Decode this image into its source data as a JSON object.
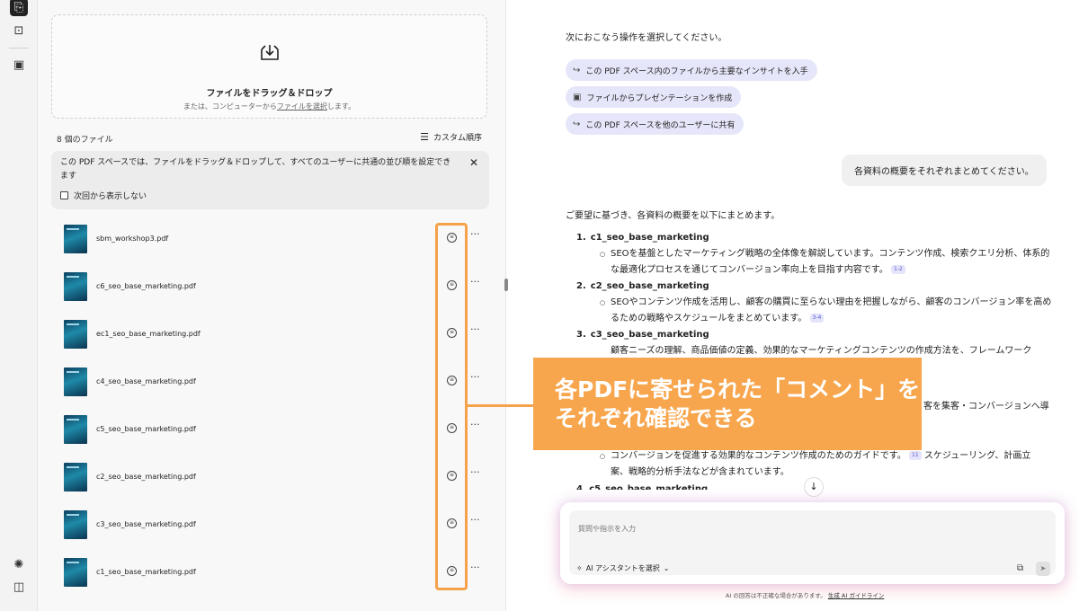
{
  "rail": {
    "icons": [
      "files-icon",
      "insight-icon",
      "presentation-icon"
    ],
    "bottom_icons": [
      "lightbulb-icon",
      "panel-toggle-icon"
    ]
  },
  "left_panel": {
    "dropzone": {
      "title": "ファイルをドラッグ＆ドロップ",
      "sub_prefix": "または、コンピューターから",
      "sub_link": "ファイルを選択",
      "sub_suffix": "します。"
    },
    "file_count": "8 個のファイル",
    "sort_label": "カスタム順序",
    "notice": {
      "text": "この PDF スペースでは、ファイルをドラッグ＆ドロップして、すべてのユーザーに共通の並び順を設定できます",
      "checkbox_label": "次回から表示しない"
    },
    "files": [
      {
        "name": "sbm_workshop3.pdf"
      },
      {
        "name": "c6_seo_base_marketing.pdf"
      },
      {
        "name": "ec1_seo_base_marketing.pdf"
      },
      {
        "name": "c4_seo_base_marketing.pdf"
      },
      {
        "name": "c5_seo_base_marketing.pdf"
      },
      {
        "name": "c2_seo_base_marketing.pdf"
      },
      {
        "name": "c3_seo_base_marketing.pdf"
      },
      {
        "name": "c1_seo_base_marketing.pdf"
      }
    ],
    "more_label": "···",
    "comment_glyph": "≡"
  },
  "callout": {
    "line1": "各PDFに寄せられた「コメント」を",
    "line2": "それぞれ確認できる",
    "color": "#f7a64d"
  },
  "right_panel": {
    "prompt_label": "次におこなう操作を選択してください。",
    "chips": [
      {
        "icon": "arrow-icon",
        "glyph": "↪",
        "label": "この PDF スペース内のファイルから主要なインサイトを入手"
      },
      {
        "icon": "presentation-icon",
        "glyph": "▣",
        "label": "ファイルからプレゼンテーションを作成"
      },
      {
        "icon": "arrow-icon",
        "glyph": "↪",
        "label": "この PDF スペースを他のユーザーに共有"
      }
    ],
    "user_message": "各資料の概要をそれぞれまとめてください。",
    "reply_intro": "ご要望に基づき、各資料の概要を以下にまとめます。",
    "summary": [
      {
        "num": "1.",
        "title": "c1_seo_base_marketing",
        "desc": "SEOを基盤としたマーケティング戦略の全体像を解説しています。コンテンツ作成、検索クエリ分析、体系的な最適化プロセスを通じてコンバージョン率向上を目指す内容です。",
        "ref": "1-2"
      },
      {
        "num": "2.",
        "title": "c2_seo_base_marketing",
        "desc": "SEOやコンテンツ作成を活用し、顧客の購買に至らない理由を把握しながら、顧客のコンバージョン率を高めるための戦略やスケジュールをまとめています。",
        "ref": "3-4"
      },
      {
        "num": "3.",
        "title": "c3_seo_base_marketing",
        "desc": "顧客ニーズの理解、商品価値の定義、効果的なマーケティングコンテンツの作成方法を、フレームワーク",
        "ref": ""
      }
    ],
    "summary_tail_1": "客を集客・コンバージョンへ導",
    "summary_tail_2": "コンバージョンを促進する効果的なコンテンツ作成のためのガイドです。",
    "summary_tail_2_ref": "11",
    "summary_tail_2_rest": "スケジューリング、計画立",
    "summary_tail_3": "案、戦略的分析手法などが含まれています。",
    "summary_cut": "4. c5_seo_base_marketing",
    "scroll_glyph": "↓",
    "input": {
      "placeholder": "質問や指示を入力",
      "ai_select": "AI アシスタントを選択",
      "ai_glyph": "✧",
      "chevron": "⌄",
      "copy_glyph": "⧉",
      "send_glyph": "➤"
    },
    "disclaimer": "AI の回答は不正確な場合があります。",
    "disclaimer_link": "生成 AI ガイドライン"
  }
}
